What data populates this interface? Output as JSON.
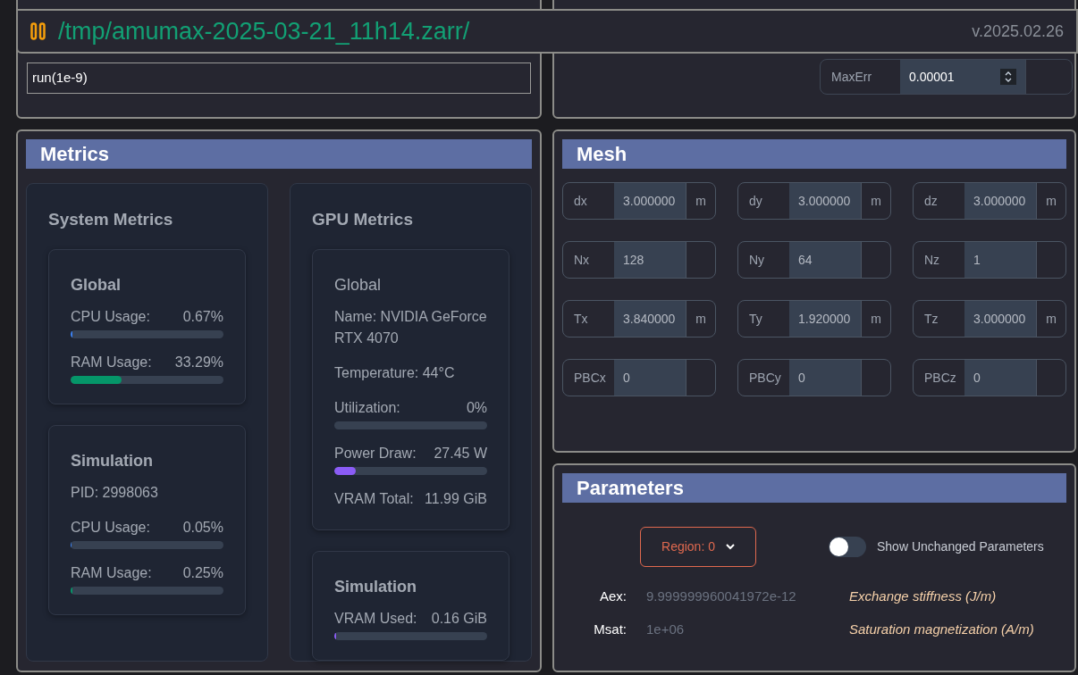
{
  "header": {
    "path": "/tmp/amumax-2025-03-21_11h14.zarr/",
    "version": "v.2025.02.26"
  },
  "console": {
    "commands": [
      "run(1e-9)"
    ]
  },
  "solver": {
    "fields": [
      {
        "label": "MaxErr",
        "value": "0.00001"
      }
    ]
  },
  "metrics": {
    "title": "Metrics",
    "columns": [
      {
        "title": "System Metrics",
        "cards": [
          {
            "title": "Global",
            "title_bold": true,
            "items": [
              {
                "kind": "bar",
                "label": "CPU Usage:",
                "reading": "0.67%",
                "level": 0.0067,
                "color": "#3b82f6"
              },
              {
                "kind": "bar",
                "label": "RAM Usage:",
                "reading": "33.29%",
                "level": 0.3329,
                "color": "#059669"
              }
            ]
          },
          {
            "title": "Simulation",
            "title_bold": true,
            "items": [
              {
                "kind": "text",
                "text": "PID: 2998063"
              },
              {
                "kind": "bar",
                "label": "CPU Usage:",
                "reading": "0.05%",
                "level": 0.0005
              },
              {
                "kind": "bar",
                "label": "RAM Usage:",
                "reading": "0.25%",
                "level": 0.0025,
                "color": "#059669"
              }
            ]
          }
        ]
      },
      {
        "title": "GPU Metrics",
        "cards": [
          {
            "title": "Global",
            "title_bold": false,
            "items": [
              {
                "kind": "text",
                "text": "Name: NVIDIA GeForce RTX 4070"
              },
              {
                "kind": "text",
                "text": "Temperature: 44°C"
              },
              {
                "kind": "bar",
                "label": "Utilization:",
                "reading": "0%"
              },
              {
                "kind": "bar",
                "label": "Power Draw:",
                "reading": "27.45 W",
                "level": 0.14,
                "color": "#8b5cf6"
              },
              {
                "kind": "pair",
                "label": "VRAM Total:",
                "reading": "11.99 GiB"
              }
            ]
          },
          {
            "title": "Simulation",
            "title_bold": true,
            "items": [
              {
                "kind": "bar",
                "label": "VRAM Used:",
                "reading": "0.16 GiB",
                "level": 0.013,
                "color": "#8b5cf6"
              }
            ]
          }
        ]
      }
    ]
  },
  "mesh": {
    "title": "Mesh",
    "fields": [
      {
        "label": "dx",
        "value": "3.000000",
        "unit": "m"
      },
      {
        "label": "dy",
        "value": "3.000000",
        "unit": "m"
      },
      {
        "label": "dz",
        "value": "3.000000",
        "unit": "m"
      },
      {
        "label": "Nx",
        "value": "128"
      },
      {
        "label": "Ny",
        "value": "64"
      },
      {
        "label": "Nz",
        "value": "1"
      },
      {
        "label": "Tx",
        "value": "3.840000",
        "unit": "m"
      },
      {
        "label": "Ty",
        "value": "1.920000",
        "unit": "m"
      },
      {
        "label": "Tz",
        "value": "3.000000",
        "unit": "m"
      },
      {
        "label": "PBCx",
        "value": "0"
      },
      {
        "label": "PBCy",
        "value": "0"
      },
      {
        "label": "PBCz",
        "value": "0"
      }
    ]
  },
  "parameters": {
    "title": "Parameters",
    "region": "Region: 0",
    "toggle": {
      "label": "Show Unchanged Parameters",
      "on": false
    },
    "rows": [
      {
        "name": "Aex:",
        "value": "9.999999960041972e-12",
        "description": "Exchange stiffness (J/m)"
      },
      {
        "name": "Msat:",
        "value": "1e+06",
        "description": "Saturation magnetization (A/m)"
      }
    ]
  }
}
